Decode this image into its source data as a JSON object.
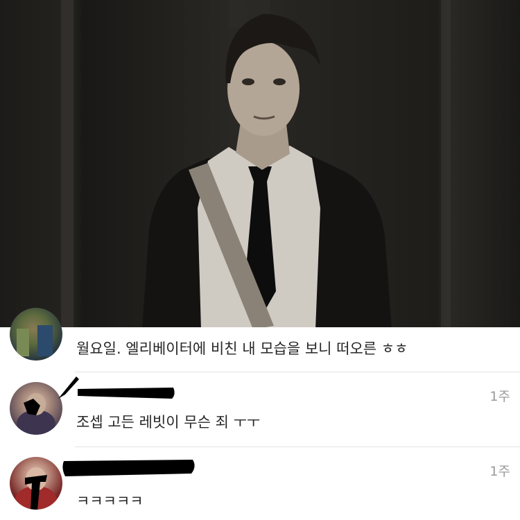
{
  "post": {
    "photo_icon": "photo-image"
  },
  "comments": [
    {
      "avatar_icon": "avatar-photo",
      "text": "월요일. 엘리베이터에 비친 내 모습을 보니 떠오른 ㅎㅎ",
      "time": ""
    },
    {
      "avatar_icon": "avatar-photo",
      "text": "조셉 고든 레빗이 무슨 죄 ㅜㅜ",
      "time": "1주"
    },
    {
      "avatar_icon": "avatar-photo",
      "text": "ㅋㅋㅋㅋㅋ",
      "time": "1주"
    }
  ],
  "colors": {
    "text": "#262626",
    "muted": "#9a9a9a",
    "divider": "#e3e3e3",
    "redaction": "#000000"
  }
}
